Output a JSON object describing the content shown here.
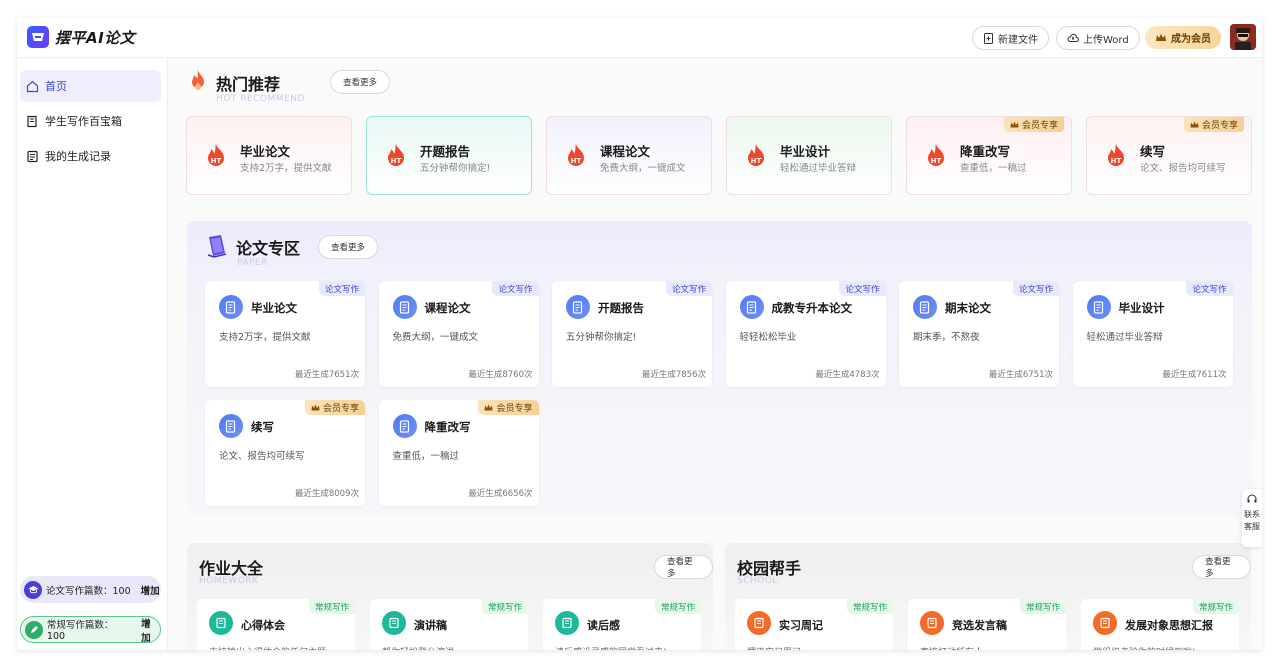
{
  "header": {
    "logo_text": "摆平AI论文",
    "new_file": "新建文件",
    "upload_word": "上传Word",
    "become_vip": "成为会员"
  },
  "sidebar": {
    "items": [
      {
        "label": "首页",
        "icon": "home-icon"
      },
      {
        "label": "学生写作百宝箱",
        "icon": "book-icon"
      },
      {
        "label": "我的生成记录",
        "icon": "records-icon"
      }
    ],
    "quota_paper": {
      "label": "论文写作篇数：100",
      "action": "增加"
    },
    "quota_regular": {
      "label": "常规写作篇数：100",
      "action": "增加"
    }
  },
  "hot": {
    "title": "热门推荐",
    "subtitle": "HOT RECOMMEND",
    "more": "查看更多",
    "cards": [
      {
        "title": "毕业论文",
        "desc": "支持2万字，提供文献",
        "bg": "#fdf1f1",
        "vip": ""
      },
      {
        "title": "开题报告",
        "desc": "五分钟帮你搞定!",
        "bg": "#e8f8f6",
        "vip": ""
      },
      {
        "title": "课程论文",
        "desc": "免费大纲，一键成文",
        "bg": "#f2f0fb",
        "vip": ""
      },
      {
        "title": "毕业设计",
        "desc": "轻松通过毕业答辩",
        "bg": "#ebf8ee",
        "vip": ""
      },
      {
        "title": "降重改写",
        "desc": "查重低，一稿过",
        "bg": "#fdeff2",
        "vip": "会员专享"
      },
      {
        "title": "续写",
        "desc": "论文、报告均可续写",
        "bg": "#fdf2f2",
        "vip": "会员专享"
      }
    ]
  },
  "paper": {
    "title": "论文专区",
    "subtitle": "PAPER",
    "more": "查看更多",
    "cards": [
      {
        "title": "毕业论文",
        "desc": "支持2万字，提供文献",
        "count": "最近生成7651次",
        "tag": "论文写作"
      },
      {
        "title": "课程论文",
        "desc": "免费大纲，一键成文",
        "count": "最近生成8760次",
        "tag": "论文写作"
      },
      {
        "title": "开题报告",
        "desc": "五分钟帮你搞定!",
        "count": "最近生成7856次",
        "tag": "论文写作"
      },
      {
        "title": "成教专升本论文",
        "desc": "轻轻松松毕业",
        "count": "最近生成4783次",
        "tag": "论文写作"
      },
      {
        "title": "期末论文",
        "desc": "期末季，不熬夜",
        "count": "最近生成6751次",
        "tag": "论文写作"
      },
      {
        "title": "毕业设计",
        "desc": "轻松通过毕业答辩",
        "count": "最近生成7611次",
        "tag": "论文写作"
      },
      {
        "title": "续写",
        "desc": "论文、报告均可续写",
        "count": "最近生成8009次",
        "tag": "会员专享"
      },
      {
        "title": "降重改写",
        "desc": "查重低，一稿过",
        "count": "最近生成6656次",
        "tag": "会员专享"
      }
    ]
  },
  "homework": {
    "title": "作业大全",
    "subtitle": "HOMEWORK",
    "more": "查看更多",
    "cards": [
      {
        "title": "心得体会",
        "desc": "支持输出心得体会的任何主题",
        "tag": "常规写作",
        "color": "#1fb89a"
      },
      {
        "title": "演讲稿",
        "desc": "帮你轻松登台演讲",
        "tag": "常规写作",
        "color": "#1fb89a"
      },
      {
        "title": "读后感",
        "desc": "读后感设灵感的同学看过来!",
        "tag": "常规写作",
        "color": "#1fb89a"
      }
    ]
  },
  "campus": {
    "title": "校园帮手",
    "subtitle": "SCHOOL",
    "more": "查看更多",
    "cards": [
      {
        "title": "实习周记",
        "desc": "摆平实习周记",
        "tag": "常规写作",
        "color": "#f26b2a"
      },
      {
        "title": "竞选发言稿",
        "desc": "直接打动所有人",
        "tag": "常规写作",
        "color": "#f26b2a"
      },
      {
        "title": "发展对象思想汇报",
        "desc": "党组织考验你的时候到啦!",
        "tag": "常规写作",
        "color": "#f26b2a"
      }
    ]
  },
  "contact": {
    "line1": "联系",
    "line2": "客服"
  }
}
